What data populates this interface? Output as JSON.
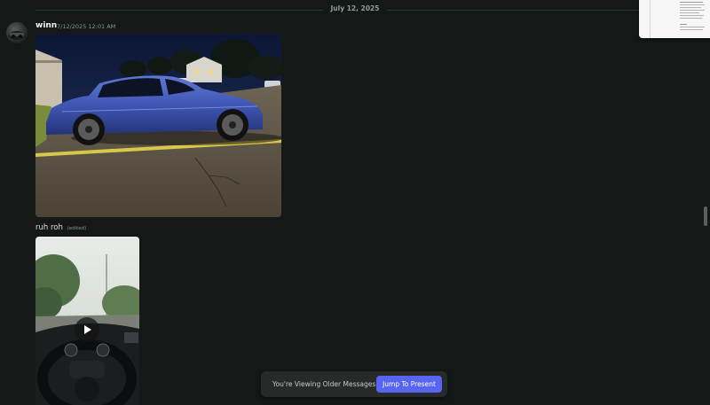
{
  "date_divider": {
    "label": "July 12, 2025"
  },
  "message": {
    "author": "winn",
    "timestamp": "7/12/2025 12:01 AM",
    "avatar_icon": "avatar-icon",
    "attachment_image_icon": "car-photo",
    "text": "ruh roh",
    "edited_tag": "(edited)",
    "video_icon": "play-icon"
  },
  "older_messages_bar": {
    "text": "You're Viewing Older Messages",
    "jump_label": "Jump To Present"
  },
  "colors": {
    "background": "#141917",
    "accent": "#5865f2",
    "car_blue": "#3f56b4"
  }
}
